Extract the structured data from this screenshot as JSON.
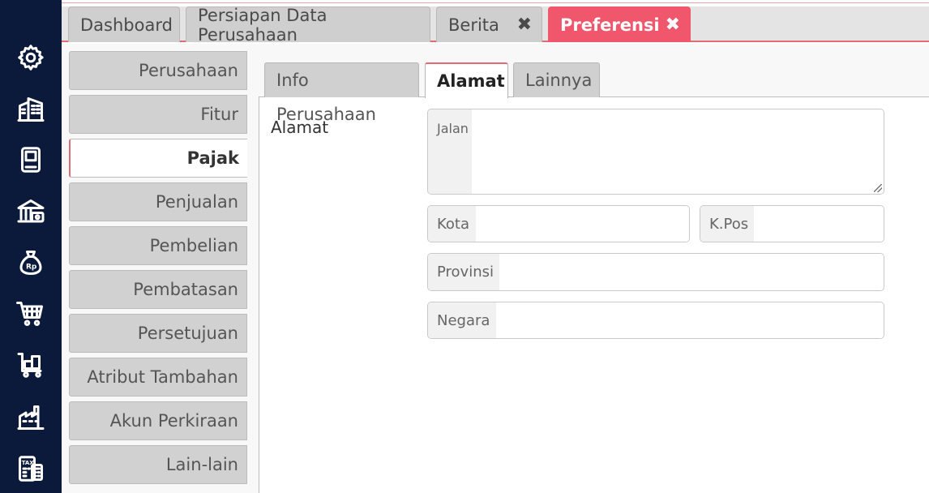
{
  "main_tabs": [
    {
      "label": "Dashboard"
    },
    {
      "label": "Persiapan Data Perusahaan"
    },
    {
      "label": "Berita",
      "close": "✖"
    },
    {
      "label": "Preferensi",
      "close": "✖"
    }
  ],
  "side_menu": [
    {
      "label": "Perusahaan"
    },
    {
      "label": "Fitur"
    },
    {
      "label": "Pajak"
    },
    {
      "label": "Penjualan"
    },
    {
      "label": "Pembelian"
    },
    {
      "label": "Pembatasan"
    },
    {
      "label": "Persetujuan"
    },
    {
      "label": "Atribut Tambahan"
    },
    {
      "label": "Akun Perkiraan"
    },
    {
      "label": "Lain-lain"
    }
  ],
  "sub_tabs": [
    {
      "label": "Info Perusahaan"
    },
    {
      "label": "Alamat"
    },
    {
      "label": "Lainnya"
    }
  ],
  "form": {
    "section_label": "Alamat",
    "jalan": {
      "addon": "Jalan",
      "value": ""
    },
    "kota": {
      "addon": "Kota",
      "value": ""
    },
    "kpos": {
      "addon": "K.Pos",
      "value": ""
    },
    "provinsi": {
      "addon": "Provinsi",
      "value": ""
    },
    "negara": {
      "addon": "Negara",
      "value": ""
    }
  },
  "rail_icons": [
    "gear-icon",
    "building-icon",
    "book-icon",
    "bank-icon",
    "money-bag-icon",
    "cart-icon",
    "cargo-cart-icon",
    "factory-icon",
    "tax-calculator-icon"
  ],
  "colors": {
    "accent": "#f0566c",
    "rail": "#0b1a3a"
  }
}
